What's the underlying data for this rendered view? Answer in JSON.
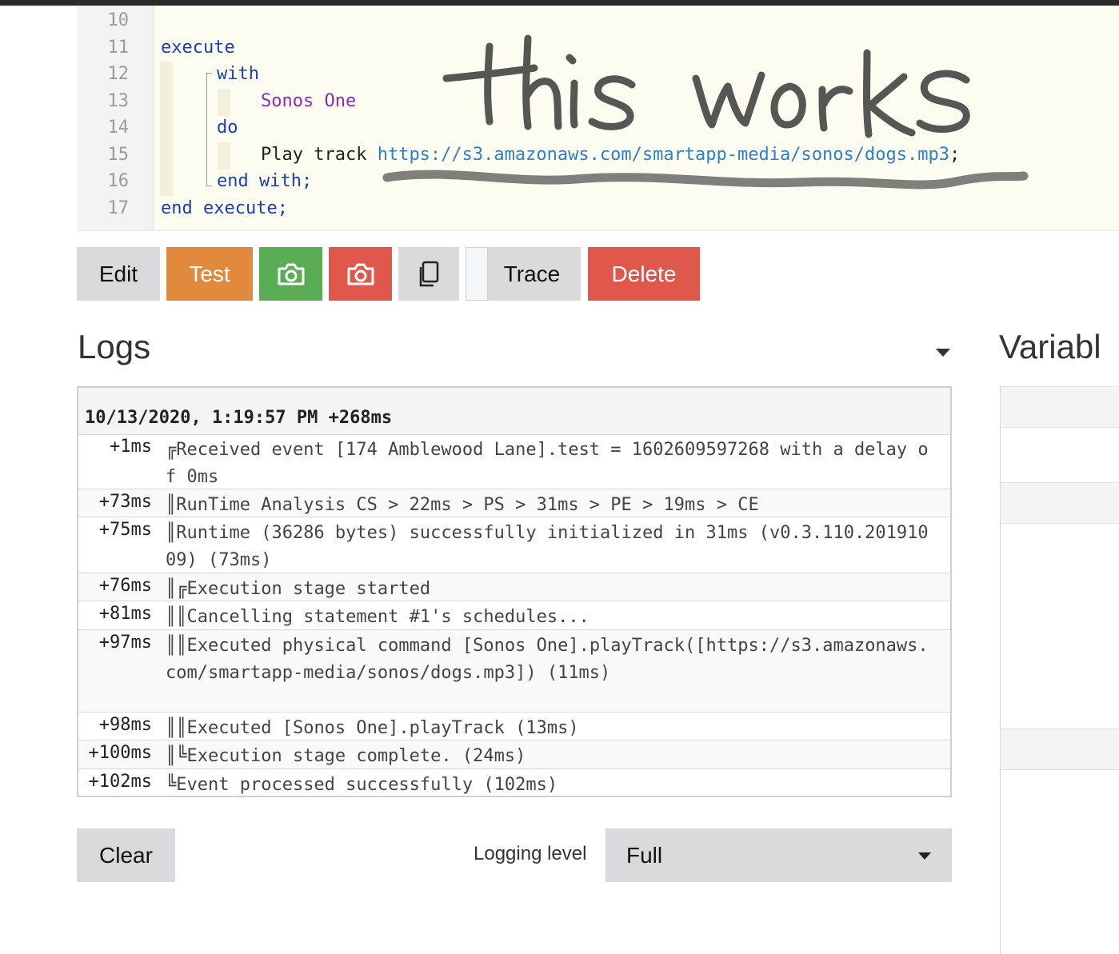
{
  "editor": {
    "line_numbers": [
      "10",
      "11",
      "12",
      "13",
      "14",
      "15",
      "16",
      "17"
    ],
    "lines": {
      "l11_execute": "execute",
      "l12_with": "with",
      "l13_device": "Sonos One",
      "l14_do": "do",
      "l15_play": "Play track ",
      "l15_url": "https://s3.amazonaws.com/smartapp-media/sonos/dogs.mp3",
      "l15_semicolon": ";",
      "l16_endwith": "end with;",
      "l17_endexecute": "end execute;"
    }
  },
  "annotation": {
    "text": "this works",
    "color": "#444444"
  },
  "toolbar": {
    "edit": "Edit",
    "test": "Test",
    "camera_green_icon": "camera-icon",
    "camera_red_icon": "camera-icon",
    "copy_icon": "copy-icon",
    "trace": "Trace",
    "delete": "Delete"
  },
  "logs": {
    "title": "Logs",
    "timestamp": "10/13/2020, 1:19:57 PM +268ms",
    "entries": [
      {
        "time": "+1ms",
        "prefix": "╔",
        "text": "Received event [174 Amblewood Lane].test = 1602609597268 with a delay of 0ms"
      },
      {
        "time": "+73ms",
        "prefix": "║",
        "text": "RunTime Analysis CS > 22ms > PS > 31ms > PE > 19ms > CE"
      },
      {
        "time": "+75ms",
        "prefix": "║",
        "text": "Runtime (36286 bytes) successfully initialized in 31ms (v0.3.110.20191009) (73ms)"
      },
      {
        "time": "+76ms",
        "prefix": "║╔",
        "text": "Execution stage started"
      },
      {
        "time": "+81ms",
        "prefix": "║║",
        "text": "Cancelling statement #1's schedules..."
      },
      {
        "time": "+97ms",
        "prefix": "║║",
        "text": "Executed physical command [Sonos One].playTrack([https://s3.amazonaws.com/smartapp-media/sonos/dogs.mp3]) (11ms)"
      },
      {
        "time": "+98ms",
        "prefix": "║║",
        "text": "Executed [Sonos One].playTrack (13ms)"
      },
      {
        "time": "+100ms",
        "prefix": "║╚",
        "text": "Execution stage complete. (24ms)"
      },
      {
        "time": "+102ms",
        "prefix": "╚",
        "text": "Event processed successfully (102ms)"
      }
    ]
  },
  "variables": {
    "title": "Variabl"
  },
  "footer": {
    "clear": "Clear",
    "logging_level_label": "Logging level",
    "logging_level_value": "Full"
  },
  "colors": {
    "test": "#e18a3d",
    "camera_green": "#5aad55",
    "danger": "#e0574b",
    "neutral": "#dadadc"
  }
}
